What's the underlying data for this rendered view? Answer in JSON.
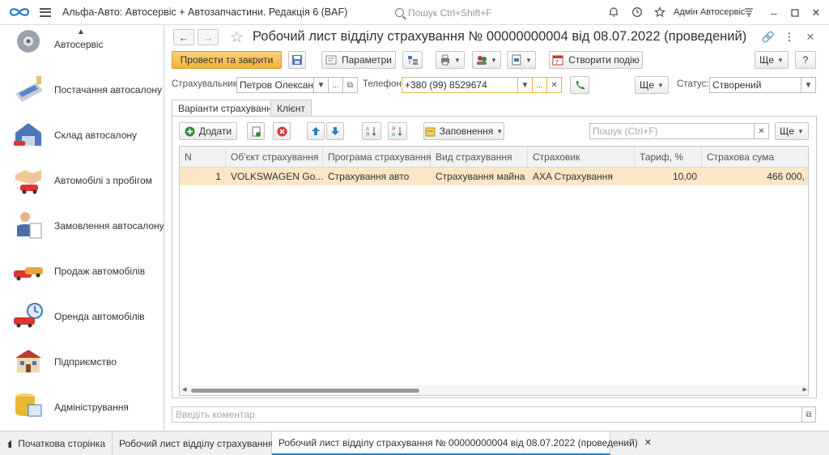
{
  "app": {
    "title": "Альфа-Авто: Автосервіс + Автозапчастини. Редакція 6  (BAF)",
    "search_placeholder": "Пошук Ctrl+Shift+F",
    "user": "Адмін Автосервіс"
  },
  "sidebar": {
    "items": [
      {
        "label": "Автосервіс",
        "icon": "gear-wheel-icon"
      },
      {
        "label": "Постачання автосалону",
        "icon": "calculator-icon"
      },
      {
        "label": "Склад автосалону",
        "icon": "warehouse-icon"
      },
      {
        "label": "Автомобілі з пробігом",
        "icon": "handshake-car-icon"
      },
      {
        "label": "Замовлення автосалону",
        "icon": "person-document-icon"
      },
      {
        "label": "Продаж автомобілів",
        "icon": "cars-sale-icon"
      },
      {
        "label": "Оренда автомобілів",
        "icon": "car-rental-icon"
      },
      {
        "label": "Підприємство",
        "icon": "building-icon"
      },
      {
        "label": "Адміністрування",
        "icon": "database-admin-icon"
      }
    ]
  },
  "form": {
    "title": "Робочий лист відділу страхування № 00000000004 від 08.07.2022 (проведений)",
    "toolbar": {
      "post_close": "Провести та закрити",
      "params": "Параметри",
      "create_event": "Створити подію",
      "more": "Ще",
      "help": "?"
    },
    "insurer_label": "Страхувальник:",
    "insurer_value": "Петров Олександр",
    "phone_label": "Телефон:",
    "phone_value": "+380 (99) 8529674",
    "more2": "Ще",
    "status_label": "Статус:",
    "status_value": "Створений",
    "tabs": [
      "Варіанти страхування",
      "Клієнт"
    ],
    "table_toolbar": {
      "add": "Додати",
      "fill": "Заповнення",
      "search_placeholder": "Пошук (Ctrl+F)",
      "more": "Ще"
    },
    "columns": [
      "N",
      "Об'єкт страхування",
      "Програма страхування",
      "Вид страхування",
      "Страховик",
      "Тариф, %",
      "Страхова сума"
    ],
    "rows": [
      [
        "1",
        "VOLKSWAGEN Go...",
        "Страхування авто",
        "Страхування майна",
        "AXA Страхування",
        "10,00",
        "466 000,"
      ]
    ],
    "comment_placeholder": "Введіть коментар"
  },
  "bottom_tabs": [
    {
      "label": "Початкова сторінка"
    },
    {
      "label": "Робочий лист відділу страхування"
    },
    {
      "label": "Робочий лист відділу страхування № 00000000004 від 08.07.2022 (проведений)"
    }
  ],
  "colors": {
    "accent": "#2b7fc0",
    "primary_button": "#f2b23a",
    "selected_row": "#fbe6c6"
  }
}
